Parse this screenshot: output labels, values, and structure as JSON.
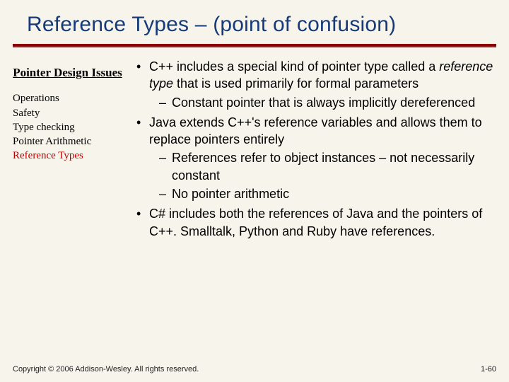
{
  "title": "Reference Types – (point of confusion)",
  "sidebar": {
    "heading": "Pointer Design Issues",
    "items": [
      {
        "label": "Operations",
        "highlight": false
      },
      {
        "label": "Safety",
        "highlight": false
      },
      {
        "label": "Type checking",
        "highlight": false
      },
      {
        "label": "Pointer Arithmetic",
        "highlight": false
      },
      {
        "label": "Reference Types",
        "highlight": true
      }
    ]
  },
  "main": {
    "bullets": [
      {
        "pre": "C++ includes a special kind of pointer type called a ",
        "ital": "reference type ",
        "post": "that is used primarily for formal parameters",
        "sub": [
          "Constant pointer that is always implicitly dereferenced"
        ]
      },
      {
        "pre": "Java extends C++'s reference variables and allows them to replace pointers entirely",
        "ital": "",
        "post": "",
        "sub": [
          "References refer to object instances – not necessarily constant",
          "No pointer arithmetic"
        ]
      },
      {
        "pre": "C# includes both the references of Java and the pointers of C++. Smalltalk, Python and Ruby have references.",
        "ital": "",
        "post": "",
        "sub": []
      }
    ]
  },
  "footer": "Copyright © 2006 Addison-Wesley. All rights reserved.",
  "pagenum": "1-60"
}
